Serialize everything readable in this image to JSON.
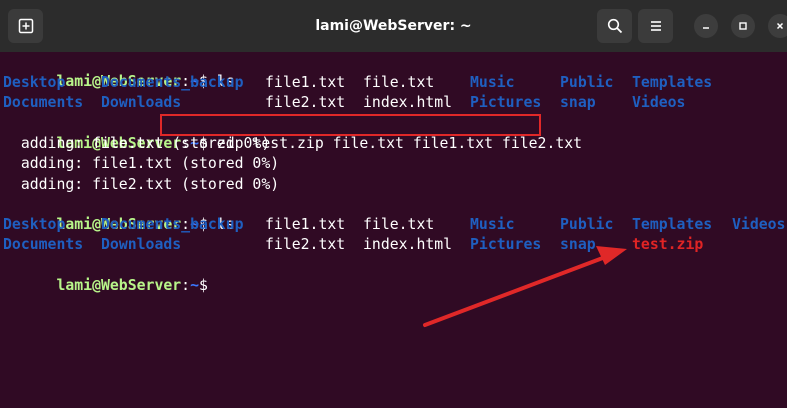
{
  "window": {
    "title": "lami@WebServer: ~"
  },
  "titlebar": {
    "new_tab_icon": "new-tab-icon",
    "search_icon": "search-icon",
    "menu_icon": "hamburger-menu-icon",
    "minimize_icon": "minimize-icon",
    "maximize_icon": "maximize-icon",
    "close_icon": "close-icon"
  },
  "terminal": {
    "prompt_user": "lami@WebServer",
    "prompt_sep": ":",
    "prompt_path": "~",
    "prompt_dollar": "$",
    "cmd_ls": " ls",
    "cmd_zip": " zip test.zip file.txt file1.txt file2.txt",
    "output_adding": [
      "  adding: file.txt (stored 0%)",
      "  adding: file1.txt (stored 0%)",
      "  adding: file2.txt (stored 0%)"
    ],
    "ls1": {
      "row1": [
        "Desktop",
        "Documents_backup",
        "file1.txt",
        "file.txt",
        "Music",
        "Public",
        "Templates"
      ],
      "row2": [
        "Documents",
        "Downloads",
        "file2.txt",
        "index.html",
        "Pictures",
        "snap",
        "Videos"
      ]
    },
    "ls2": {
      "row1": [
        "Desktop",
        "Documents_backup",
        "file1.txt",
        "file.txt",
        "Music",
        "Public",
        "Templates",
        "Videos"
      ],
      "row2": [
        "Documents",
        "Downloads",
        "file2.txt",
        "index.html",
        "Pictures",
        "snap",
        "test.zip"
      ]
    }
  },
  "colors": {
    "background": "#300a24",
    "prompt_user": "#b8f58a",
    "prompt_path": "#3b78ff",
    "directory": "#1f5fc0",
    "archive": "#e02424",
    "annotation": "#e02828"
  }
}
